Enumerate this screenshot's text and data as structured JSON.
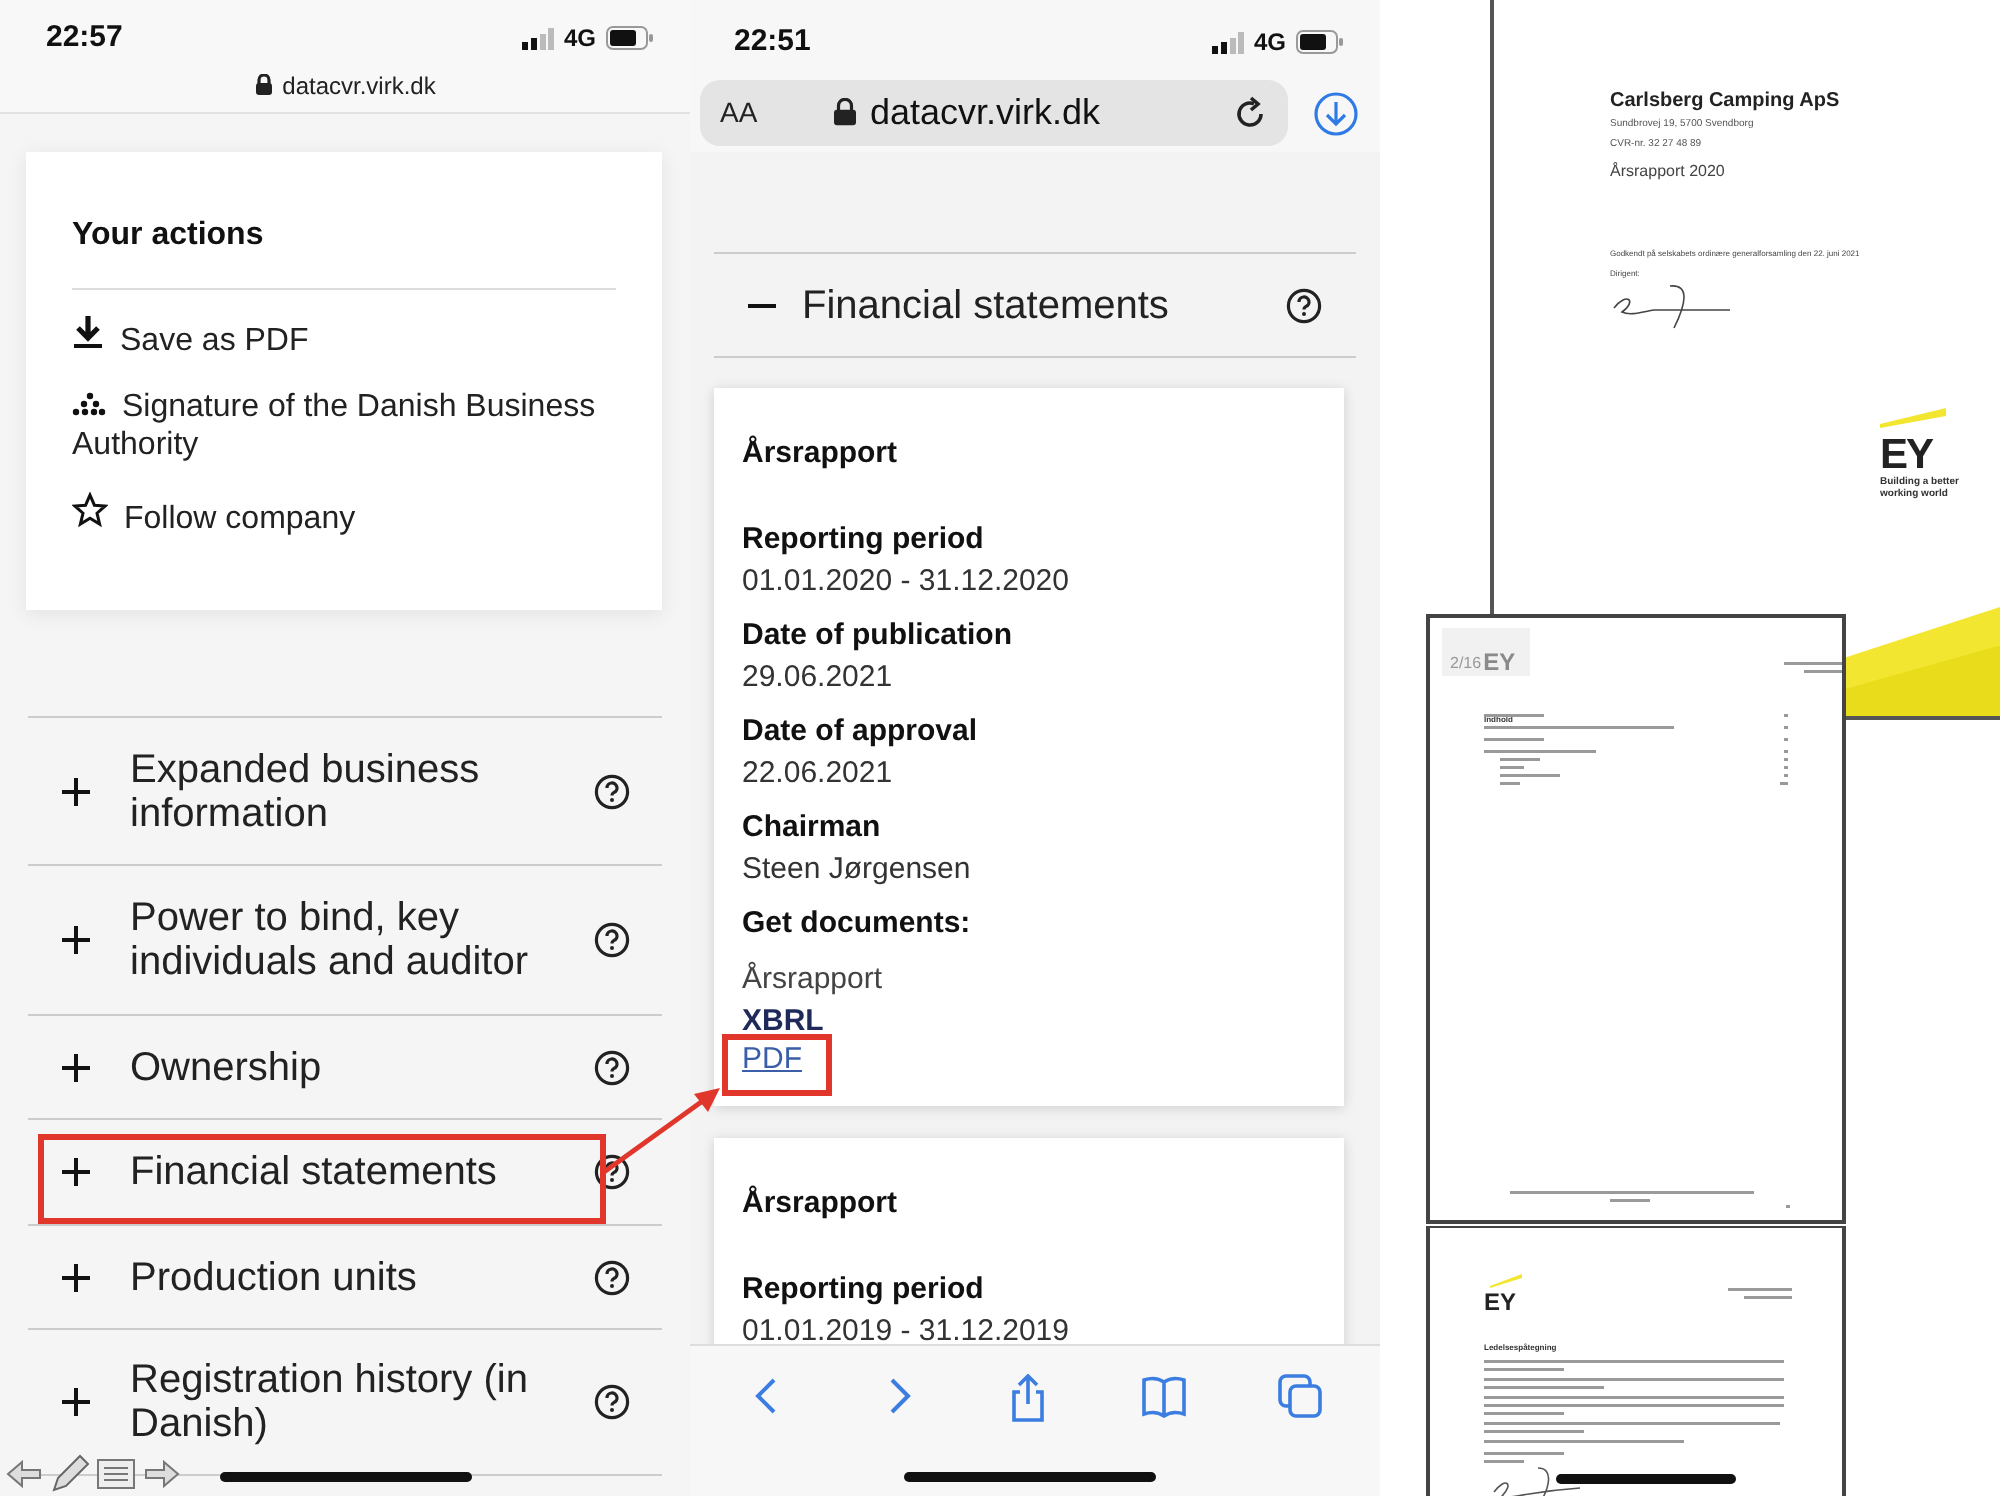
{
  "left_phone": {
    "status_time": "22:57",
    "network": "4G",
    "url": "datacvr.virk.dk",
    "actions_card": {
      "title": "Your actions",
      "items": [
        {
          "kind": "download",
          "label": "Save as PDF"
        },
        {
          "kind": "signature",
          "label": "Signature of the Danish Business Authority"
        },
        {
          "kind": "star",
          "label": "Follow company"
        }
      ]
    },
    "sections": [
      {
        "label": "Expanded business information",
        "expanded": false
      },
      {
        "label": "Power to bind, key individuals and auditor",
        "expanded": false
      },
      {
        "label": "Ownership",
        "expanded": false
      },
      {
        "label": "Financial statements",
        "expanded": false
      },
      {
        "label": "Production units",
        "expanded": false
      },
      {
        "label": "Registration history (in Danish)",
        "expanded": false
      }
    ]
  },
  "middle_phone": {
    "status_time": "22:51",
    "network": "4G",
    "text_size_button": "AA",
    "url": "datacvr.virk.dk",
    "section": {
      "label": "Financial statements",
      "expanded": true
    },
    "reports": [
      {
        "title": "Årsrapport",
        "fields": [
          {
            "label": "Reporting period",
            "value": "01.01.2020 - 31.12.2020"
          },
          {
            "label": "Date of publication",
            "value": "29.06.2021"
          },
          {
            "label": "Date of approval",
            "value": "22.06.2021"
          },
          {
            "label": "Chairman",
            "value": "Steen Jørgensen"
          }
        ],
        "documents_label": "Get documents:",
        "documents": [
          {
            "kind": "name",
            "label": "Årsrapport"
          },
          {
            "kind": "format",
            "label": "XBRL"
          },
          {
            "kind": "link",
            "label": "PDF"
          }
        ]
      },
      {
        "title": "Årsrapport",
        "fields": [
          {
            "label": "Reporting period",
            "value": "01.01.2019 - 31.12.2019"
          }
        ]
      }
    ]
  },
  "documents": {
    "cover": {
      "company": "Carlsberg Camping ApS",
      "address": "Sundbrovej 19, 5700 Svendborg",
      "cvr": "CVR-nr. 32 27 48 89",
      "title": "Årsrapport 2020",
      "approval": "Godkendt på selskabets ordinære generalforsamling den 22. juni 2021",
      "chairman_label": "Dirigent:",
      "logo": "EY",
      "tagline": "Building a better working world"
    },
    "contents_page": {
      "page_badge": "2/16",
      "logo": "EY",
      "heading": "Indhold"
    },
    "statement_page": {
      "logo": "EY",
      "heading": "Ledelsespåtegning"
    }
  }
}
